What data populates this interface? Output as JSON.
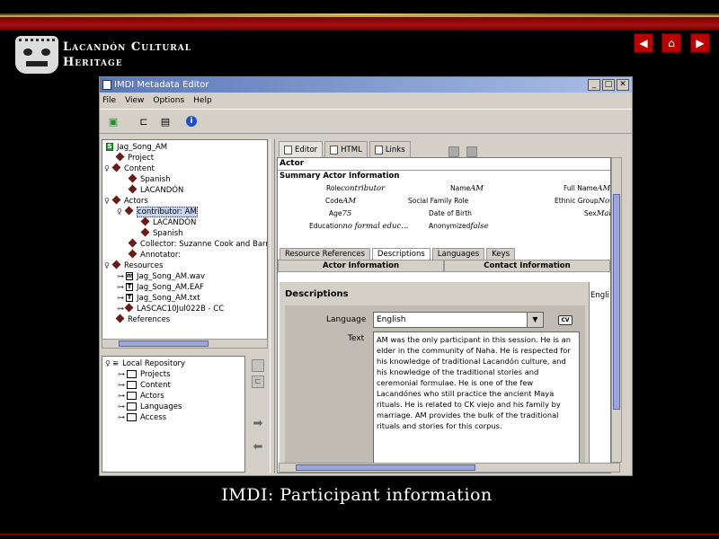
{
  "slide": {
    "title_line1": "Lacandón Cultural",
    "title_line2": "Heritage",
    "caption": "IMDI: Participant information",
    "nav": {
      "prev": "◀",
      "home": "⌂",
      "next": "▶"
    }
  },
  "window": {
    "title": "IMDI Metadata Editor",
    "controls": {
      "min": "_",
      "max": "□",
      "close": "✕"
    }
  },
  "menu": [
    "File",
    "View",
    "Options",
    "Help"
  ],
  "tree": {
    "rows": [
      {
        "label": "Jag_Song_AM",
        "kind": "session"
      },
      {
        "label": "Project",
        "kind": "node"
      },
      {
        "label": "Content",
        "kind": "node"
      },
      {
        "label": "Spanish",
        "kind": "node"
      },
      {
        "label": "LACANDÓN",
        "kind": "node"
      },
      {
        "label": "Actors",
        "kind": "node"
      },
      {
        "label": "contributor: AM",
        "kind": "node"
      },
      {
        "label": "LACANDÓN",
        "kind": "node"
      },
      {
        "label": "Spanish",
        "kind": "node"
      },
      {
        "label": "Collector: Suzanne Cook and Barr",
        "kind": "node"
      },
      {
        "label": "Annotator:",
        "kind": "node"
      },
      {
        "label": "Resources",
        "kind": "node"
      },
      {
        "label": "Jag_Song_AM.wav",
        "kind": "file-m"
      },
      {
        "label": "Jag_Song_AM.EAF",
        "kind": "file-t"
      },
      {
        "label": "Jag_Song_AM.txt",
        "kind": "file-t"
      },
      {
        "label": "LASCAC10Jul022B - CC",
        "kind": "node"
      },
      {
        "label": "References",
        "kind": "node"
      }
    ]
  },
  "repository": {
    "root": "Local Repository",
    "items": [
      "Projects",
      "Content",
      "Actors",
      "Languages",
      "Access"
    ]
  },
  "editor": {
    "tabs": [
      "Editor",
      "HTML",
      "Links"
    ],
    "section": "Actor",
    "summary_title": "Summary Actor Information",
    "summary": {
      "role_label": "Role",
      "role_value": "contributor",
      "name_label": "Name",
      "name_value": "AM",
      "fullname_label": "Full Name",
      "fullname_value": "AM",
      "code_label": "Code",
      "code_value": "AM",
      "family_label": "Social Family Role",
      "ethnic_label": "Ethnic Group",
      "ethnic_value": "Non",
      "age_label": "Age",
      "age_value": "75",
      "dob_label": "Date of Birth",
      "sex_label": "Sex",
      "sex_value": "Mal",
      "edu_label": "Education",
      "edu_value": "no formal educ...",
      "anon_label": "Anonymized",
      "anon_value": "false"
    },
    "subtabs": [
      "Resource References",
      "Descriptions",
      "Languages",
      "Keys"
    ],
    "subtabs2": [
      "Actor Information",
      "Contact Information"
    ],
    "descriptions": {
      "title": "Descriptions",
      "language_label": "Language",
      "language_value": "English",
      "cv_label": "CV",
      "text_label": "Text",
      "text_value": "AM was the only participant in this session.  He is an elder in the community of Naha.  He is respected for his knowledge of traditional Lacandón culture, and his knowledge of the traditional stories and ceremonial formulae.  He is one of the few Lacandónes who still practice the ancient Maya rituals. He is related to CK viejo and his family by marriage. AM provides the bulk of the traditional rituals and stories for this corpus.",
      "side_label": "Englis"
    }
  }
}
